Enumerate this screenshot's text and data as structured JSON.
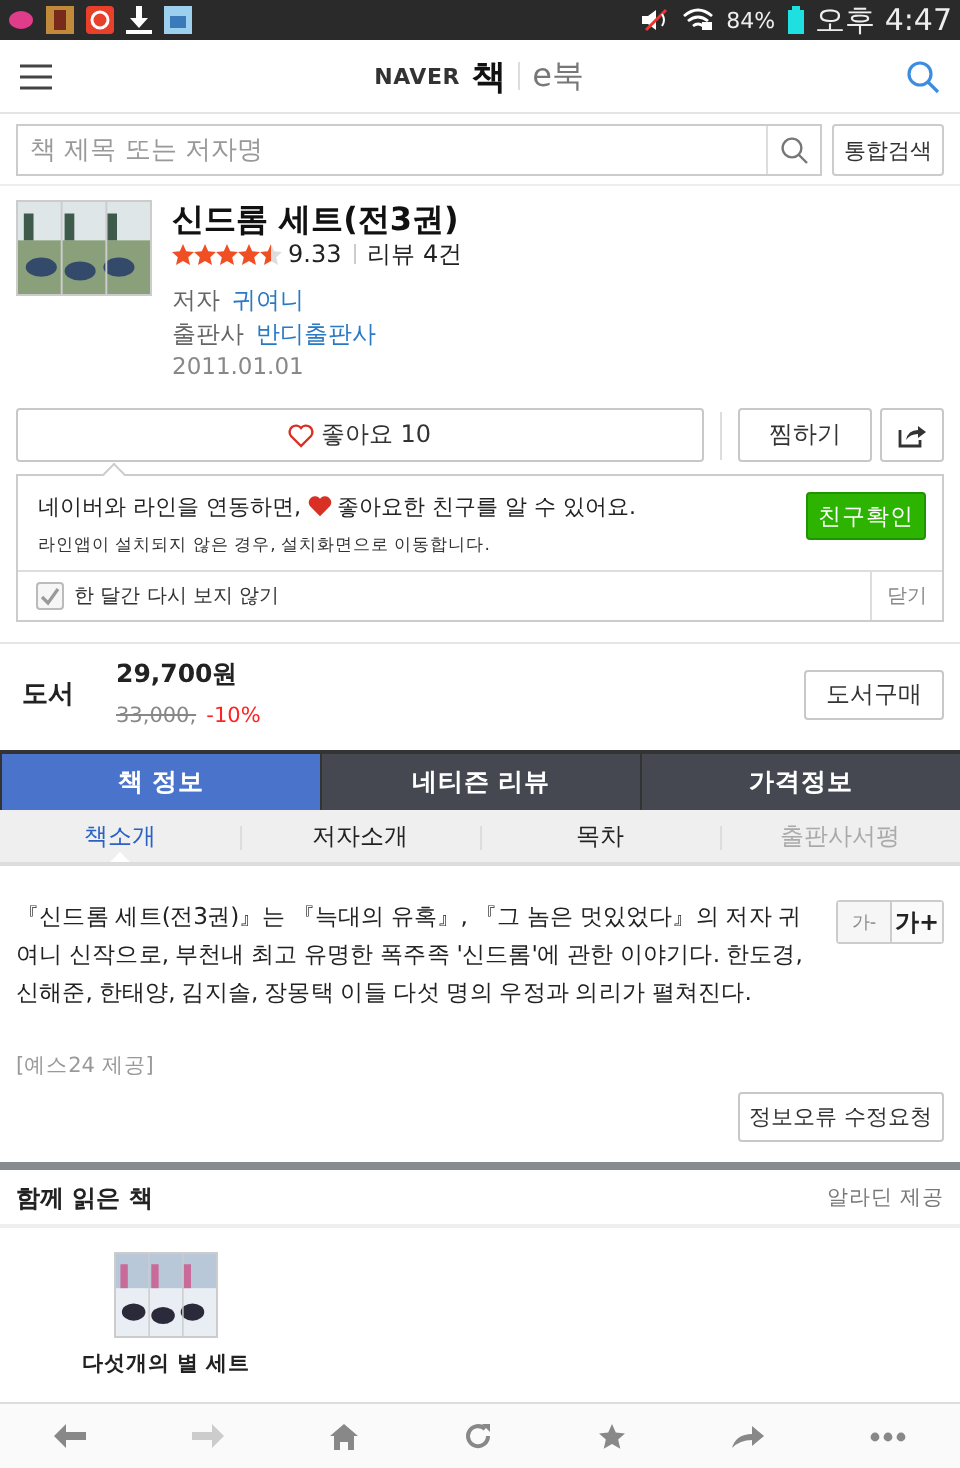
{
  "status_bar": {
    "battery": "84%",
    "time": "오후 4:47"
  },
  "header": {
    "brand": "NAVER",
    "section": "책",
    "alt_section": "e북"
  },
  "search": {
    "placeholder": "책 제목 또는 저자명",
    "button": "통합검색"
  },
  "book": {
    "title": "신드롬 세트(전3권)",
    "stars": 4.5,
    "rating": "9.33",
    "reviews": "리뷰 4건",
    "author_label": "저자",
    "author": "귀여니",
    "publisher_label": "출판사",
    "publisher": "반디출판사",
    "date": "2011.01.01"
  },
  "actions": {
    "like": "좋아요 10",
    "liked": false,
    "wish": "찜하기"
  },
  "line_notice": {
    "message_before": "네이버와 라인을 연동하면,",
    "message_after": "좋아요한 친구를 알 수 있어요.",
    "sub": "라인앱이 설치되지 않은 경우, 설치화면으로 이동합니다.",
    "button": "친구확인",
    "checkbox": {
      "label": "한 달간 다시 보지 않기",
      "checked": true
    },
    "close": "닫기"
  },
  "price": {
    "type": "도서",
    "price": "29,700원",
    "original": "33,000,",
    "discount": "-10%",
    "buy": "도서구매"
  },
  "tabs": [
    {
      "label": "책 정보",
      "selected": true
    },
    {
      "label": "네티즌 리뷰",
      "selected": false
    },
    {
      "label": "가격정보",
      "selected": false
    }
  ],
  "subtabs": [
    {
      "label": "책소개",
      "selected": true,
      "disabled": false
    },
    {
      "label": "저자소개",
      "selected": false,
      "disabled": false
    },
    {
      "label": "목차",
      "selected": false,
      "disabled": false
    },
    {
      "label": "출판사서평",
      "selected": false,
      "disabled": true
    }
  ],
  "description": {
    "text": "『신드롬 세트(전3권)』는 『늑대의 유혹』, 『그 놈은 멋있었다』의 저자 귀여니 신작으로, 부천내 최고 유명한 폭주족 '신드롬'에 관한 이야기다. 한도경, 신해준, 한태양, 김지솔, 장몽택 이들 다섯 명의 우정과 의리가 펼쳐진다.",
    "font_smaller": "가-",
    "font_larger": "가+",
    "source": "[예스24 제공]",
    "report": "정보오류 수정요청"
  },
  "related": {
    "title": "함께 읽은 책",
    "provider": "알라딘 제공",
    "books": [
      {
        "title": "다섯개의 별 세트"
      }
    ]
  },
  "browser_bar": {
    "forward_disabled": true
  }
}
